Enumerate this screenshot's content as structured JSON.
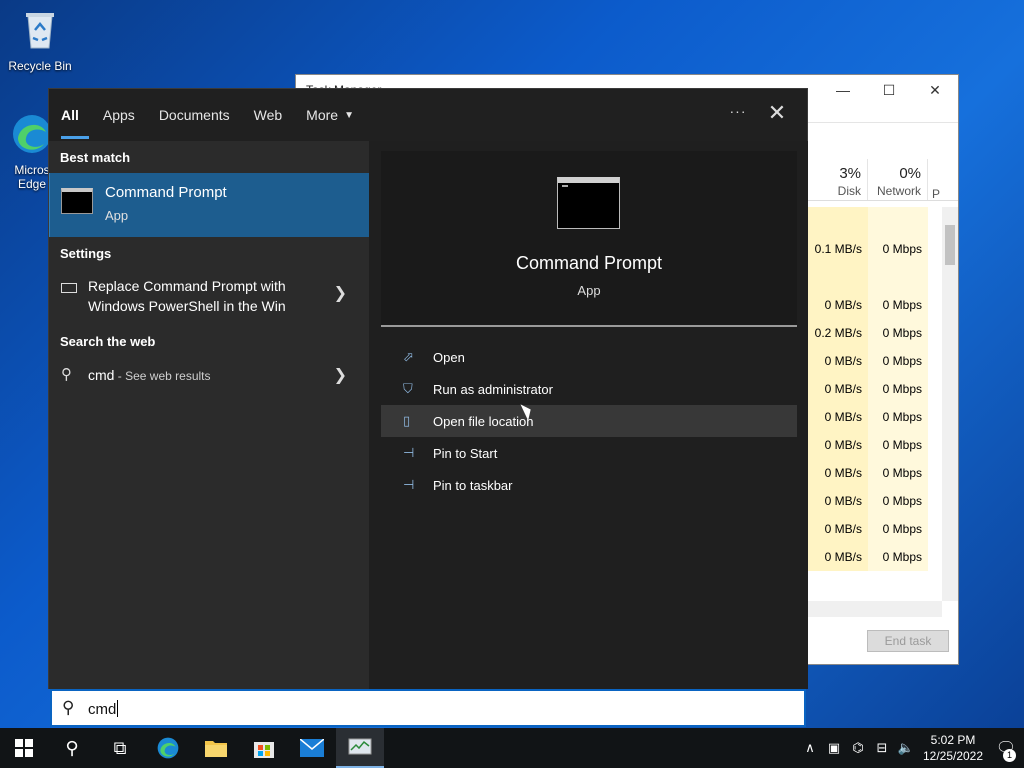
{
  "desktop": {
    "recycle_label": "Recycle Bin",
    "edge_label_1": "Micros",
    "edge_label_2": "Edge"
  },
  "taskmgr": {
    "title": "Task Manager",
    "columns": [
      {
        "pct": "3%",
        "label": "Disk"
      },
      {
        "pct": "0%",
        "label": "Network"
      }
    ],
    "col3_label": "P",
    "rows": [
      {
        "disk": "",
        "net": ""
      },
      {
        "disk": "0.1 MB/s",
        "net": "0 Mbps"
      },
      {
        "disk": "",
        "net": ""
      },
      {
        "disk": "0 MB/s",
        "net": "0 Mbps"
      },
      {
        "disk": "0.2 MB/s",
        "net": "0 Mbps"
      },
      {
        "disk": "0 MB/s",
        "net": "0 Mbps"
      },
      {
        "disk": "0 MB/s",
        "net": "0 Mbps"
      },
      {
        "disk": "0 MB/s",
        "net": "0 Mbps"
      },
      {
        "disk": "0 MB/s",
        "net": "0 Mbps"
      },
      {
        "disk": "0 MB/s",
        "net": "0 Mbps"
      },
      {
        "disk": "0 MB/s",
        "net": "0 Mbps"
      },
      {
        "disk": "0 MB/s",
        "net": "0 Mbps"
      },
      {
        "disk": "0 MB/s",
        "net": "0 Mbps"
      }
    ],
    "end_task_label": "End task"
  },
  "search": {
    "tabs": [
      "All",
      "Apps",
      "Documents",
      "Web",
      "More"
    ],
    "active_tab": "All",
    "dots": "···",
    "close": "✕",
    "best_match_heading": "Best match",
    "best_match": {
      "title": "Command Prompt",
      "subtitle": "App"
    },
    "settings_heading": "Settings",
    "settings_item": "Replace Command Prompt with Windows PowerShell in the Win",
    "web_heading": "Search the web",
    "web_item": {
      "query": "cmd",
      "suffix": " - See web results"
    },
    "preview": {
      "title": "Command Prompt",
      "subtitle": "App"
    },
    "actions": [
      {
        "label": "Open",
        "icon": "open-icon"
      },
      {
        "label": "Run as administrator",
        "icon": "shield-icon"
      },
      {
        "label": "Open file location",
        "icon": "folder-location-icon"
      },
      {
        "label": "Pin to Start",
        "icon": "pin-icon"
      },
      {
        "label": "Pin to taskbar",
        "icon": "pin-icon"
      }
    ],
    "hovered_action": "Open file location",
    "box_value": "cmd"
  },
  "taskbar": {
    "time": "5:02 PM",
    "date": "12/25/2022",
    "notification_count": "1"
  },
  "colors": {
    "accent": "#0a64c2",
    "selected": "#1d5d8f"
  }
}
